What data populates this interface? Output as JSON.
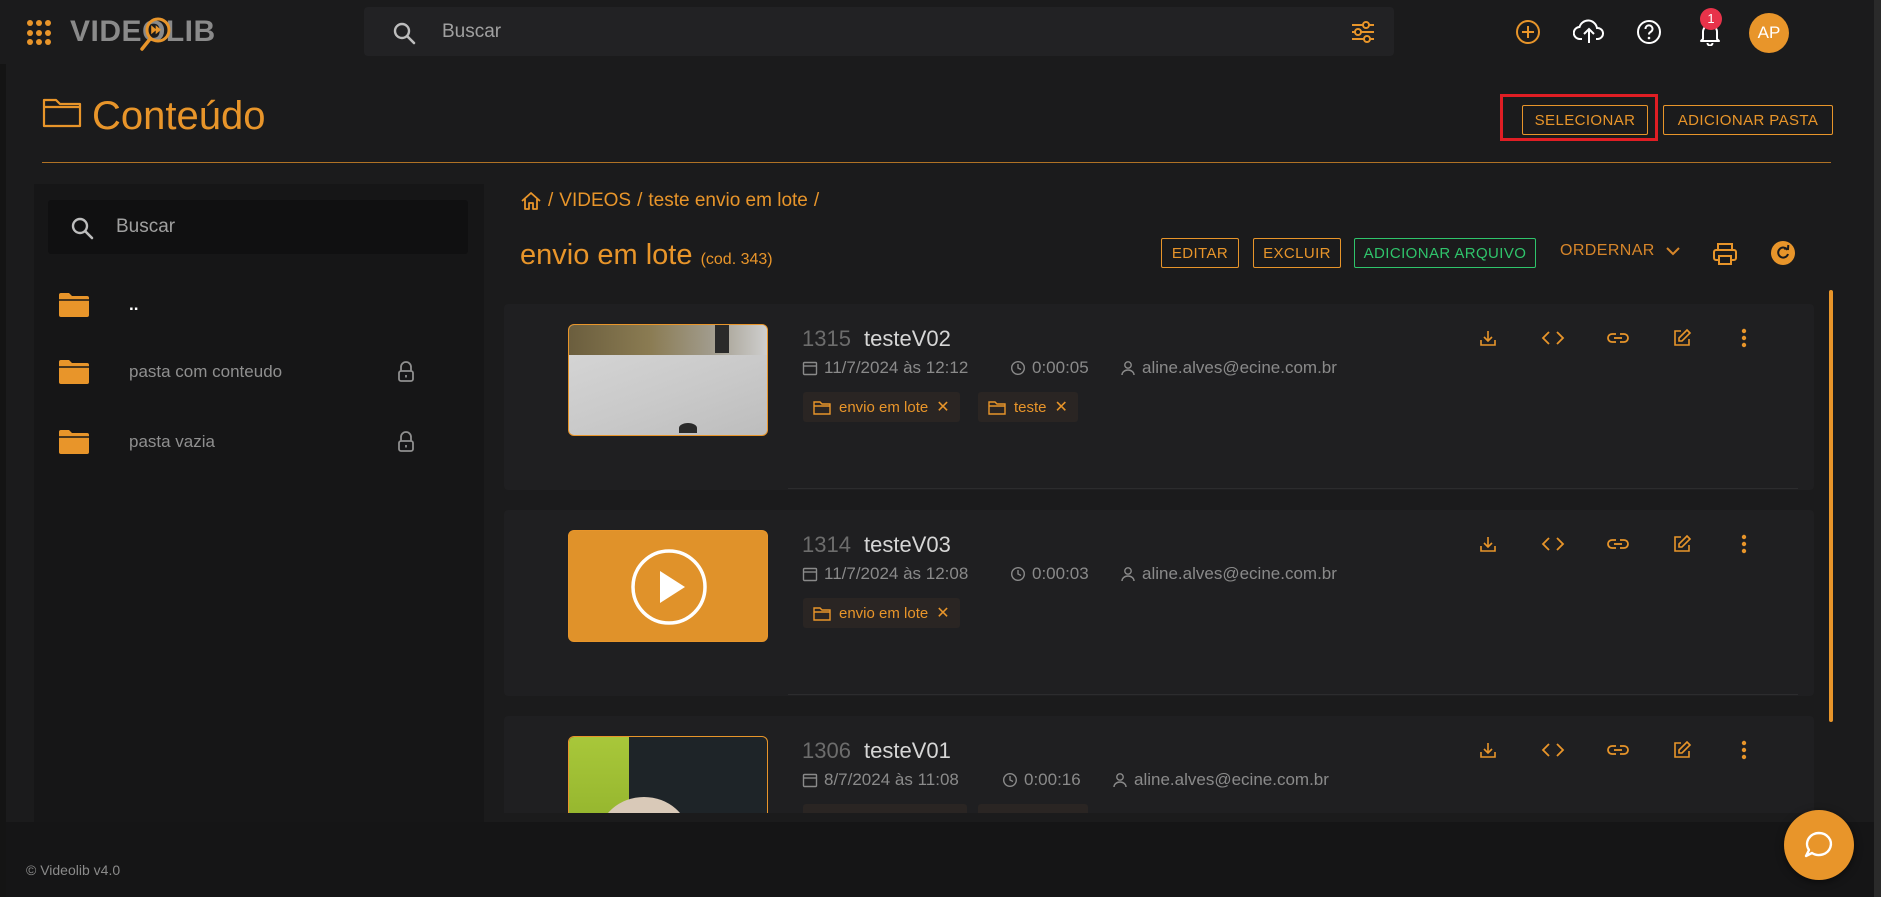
{
  "app": {
    "logo_text": "VIDEOLIB",
    "search_placeholder": "Buscar",
    "notification_count": "1",
    "user_initials": "AP"
  },
  "page": {
    "title": "Conteúdo",
    "select_button": "SELECIONAR",
    "add_folder_button": "ADICIONAR PASTA"
  },
  "sidebar": {
    "search_placeholder": "Buscar",
    "folders": [
      {
        "label": "..",
        "locked": false
      },
      {
        "label": "pasta com conteudo",
        "locked": true
      },
      {
        "label": "pasta vazia",
        "locked": true
      }
    ]
  },
  "breadcrumb": {
    "items": [
      "VIDEOS",
      "teste envio em lote"
    ],
    "separator": "/"
  },
  "folder": {
    "name": "envio em lote",
    "code": "(cod. 343)",
    "edit_button": "EDITAR",
    "delete_button": "EXCLUIR",
    "add_file_button": "ADICIONAR ARQUIVO",
    "sort_button": "ORDERNAR"
  },
  "videos": [
    {
      "id": "1315",
      "title": "testeV02",
      "date": "11/7/2024 às 12:12",
      "duration": "0:00:05",
      "user": "aline.alves@ecine.com.br",
      "tags": [
        "envio em lote",
        "teste"
      ],
      "thumb": "photo-wall"
    },
    {
      "id": "1314",
      "title": "testeV03",
      "date": "11/7/2024 às 12:08",
      "duration": "0:00:03",
      "user": "aline.alves@ecine.com.br",
      "tags": [
        "envio em lote"
      ],
      "thumb": "play-placeholder"
    },
    {
      "id": "1306",
      "title": "testeV01",
      "date": "8/7/2024 às 11:08",
      "duration": "0:00:16",
      "user": "aline.alves@ecine.com.br",
      "tags": [],
      "thumb": "photo-green"
    }
  ],
  "footer": {
    "version": "© Videolib v4.0"
  },
  "colors": {
    "accent": "#e8952a",
    "success": "#2fc46b",
    "highlight": "#e01e24",
    "badge": "#e8334a"
  }
}
